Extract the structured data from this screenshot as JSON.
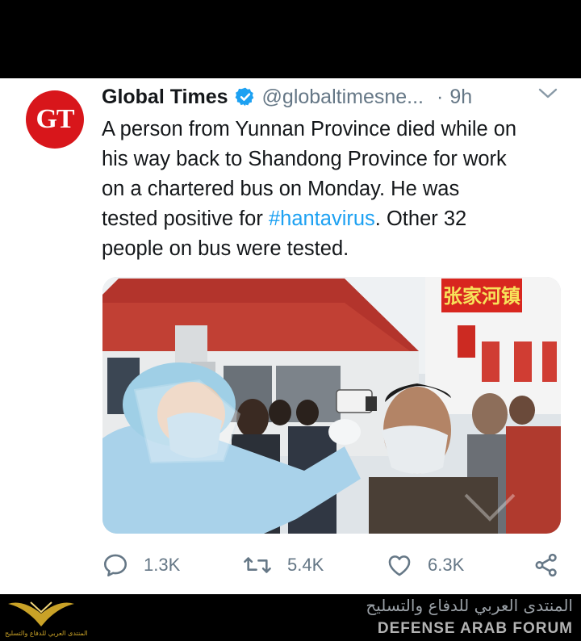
{
  "tweet": {
    "avatar_text": "GT",
    "display_name": "Global Times",
    "handle": "@globaltimesne...",
    "separator": "·",
    "time": "9h",
    "text_lines": [
      "A person from Yunnan Province died while on",
      "his way back to Shandong Province for work",
      "on a chartered bus on Monday. He was"
    ],
    "line4_before": "tested positive for ",
    "hashtag": "#hantavirus",
    "line4_after": ". Other 32",
    "line5": "people on bus were tested.",
    "media": {
      "sign_text": "张家河镇"
    },
    "actions": {
      "reply_count": "1.3K",
      "retweet_count": "5.4K",
      "like_count": "6.3K"
    }
  },
  "watermark": {
    "arabic": "المنتدى العربي للدفاع والتسليح",
    "english": "DEFENSE ARAB FORUM",
    "logo_small_text": "المنتدى العربي للدفاع والتسليح"
  },
  "colors": {
    "hashtag": "#1da1f2",
    "avatar_bg": "#d8161b",
    "verified": "#1da1f2",
    "muted": "#657786"
  },
  "icons": [
    "verified-badge-icon",
    "chevron-down-icon",
    "reply-icon",
    "retweet-icon",
    "like-icon",
    "share-icon"
  ]
}
